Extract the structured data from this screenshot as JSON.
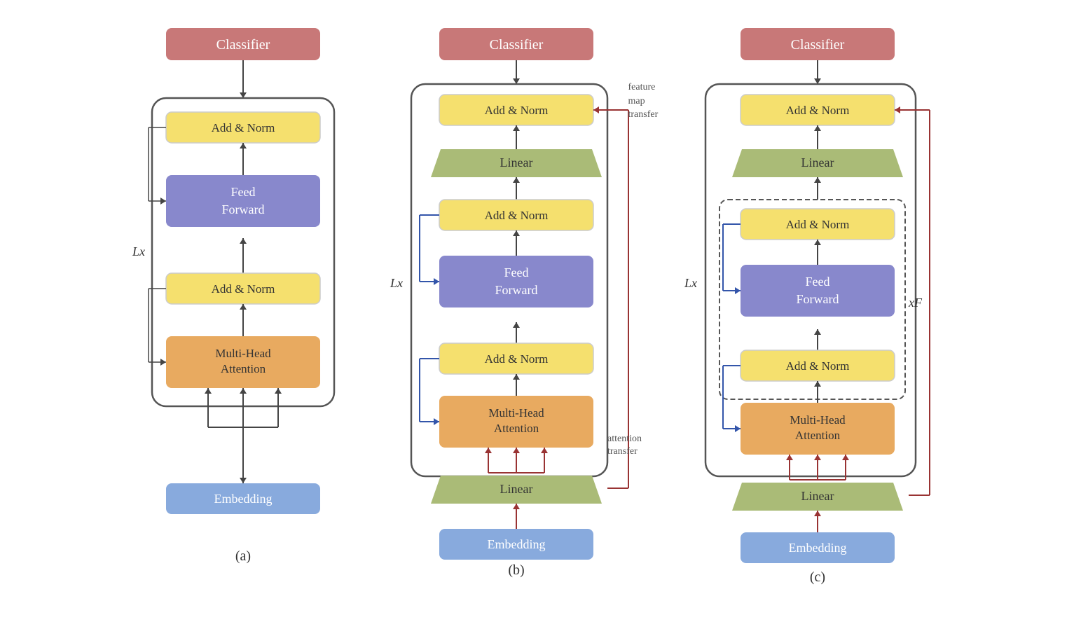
{
  "diagrams": {
    "a": {
      "caption": "(a)",
      "classifier": "Classifier",
      "add_norm_1": "Add & Norm",
      "add_norm_2": "Add & Norm",
      "feed_forward": "Feed\nForward",
      "multi_head": "Multi-Head\nAttention",
      "embedding": "Embedding",
      "lx": "Lx"
    },
    "b": {
      "caption": "(b)",
      "classifier": "Classifier",
      "add_norm_top": "Add & Norm",
      "linear_top": "Linear",
      "add_norm_2": "Add & Norm",
      "feed_forward": "Feed\nForward",
      "add_norm_1": "Add & Norm",
      "multi_head": "Multi-Head\nAttention",
      "linear_bottom": "Linear",
      "embedding": "Embedding",
      "lx": "Lx",
      "attention_transfer": "attention\ntransfer",
      "feature_map_transfer": "feature map\ntransfer"
    },
    "c": {
      "caption": "(c)",
      "classifier": "Classifier",
      "add_norm_top": "Add & Norm",
      "linear_top": "Linear",
      "add_norm_2": "Add & Norm",
      "feed_forward": "Feed\nForward",
      "add_norm_1": "Add & Norm",
      "multi_head": "Multi-Head\nAttention",
      "linear_bottom": "Linear",
      "embedding": "Embedding",
      "lx": "Lx",
      "xf": "xF"
    }
  },
  "colors": {
    "classifier": "#c87878",
    "add_norm": "#f5e06e",
    "feed_forward": "#8888cc",
    "multi_head": "#e8aa60",
    "embedding": "#88aadd",
    "linear": "#aabb77",
    "blue_arrow": "#3355aa",
    "red_arrow": "#993333",
    "dark_arrow": "#444444"
  }
}
